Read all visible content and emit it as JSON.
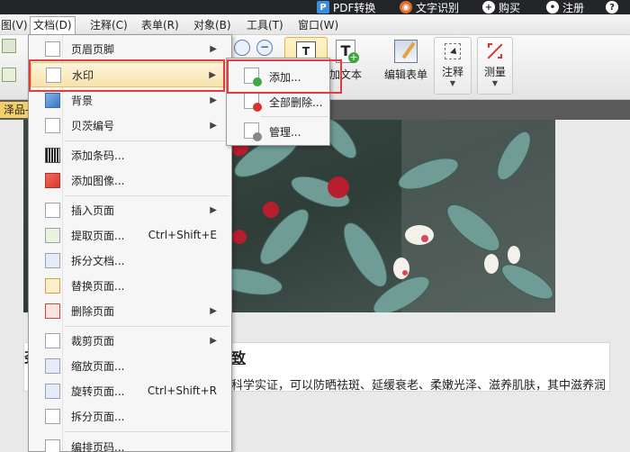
{
  "top_strip": {
    "pdf_convert": "PDF转换",
    "ocr": "文字识别",
    "buy": "购买",
    "register": "注册"
  },
  "menubar": {
    "items": [
      {
        "label": "图(V)"
      },
      {
        "label": "文档(D)"
      },
      {
        "label": "注释(C)"
      },
      {
        "label": "表单(R)"
      },
      {
        "label": "对象(B)"
      },
      {
        "label": "工具(T)"
      },
      {
        "label": "窗口(W)"
      }
    ]
  },
  "toolbar": {
    "add_text": "加文本",
    "edit_form": "编辑表单",
    "annotate": "注释",
    "measure": "测量"
  },
  "tab": {
    "label": "泽品-"
  },
  "document_menu": {
    "items": [
      {
        "label": "页眉页脚",
        "arrow": "▶"
      },
      {
        "label": "水印",
        "arrow": "▶"
      },
      {
        "label": "背景",
        "arrow": "▶"
      },
      {
        "label": "贝茨编号",
        "arrow": "▶"
      },
      {
        "label": "添加条码..."
      },
      {
        "label": "添加图像..."
      },
      {
        "label": "插入页面",
        "arrow": "▶"
      },
      {
        "label": "提取页面...",
        "shortcut": "Ctrl+Shift+E"
      },
      {
        "label": "拆分文档..."
      },
      {
        "label": "替换页面..."
      },
      {
        "label": "删除页面",
        "arrow": "▶"
      },
      {
        "label": "裁剪页面",
        "arrow": "▶"
      },
      {
        "label": "缩放页面..."
      },
      {
        "label": "旋转页面...",
        "shortcut": "Ctrl+Shift+R"
      },
      {
        "label": "拆分页面..."
      },
      {
        "label": "编排页码..."
      }
    ]
  },
  "watermark_submenu": {
    "items": [
      {
        "label": "添加..."
      },
      {
        "label": "全部删除..."
      },
      {
        "label": "管理..."
      }
    ]
  },
  "document": {
    "heading_lead": "劲",
    "heading": "致",
    "body": "科学实证，可以防晒祛斑、延缓衰老、柔嫩光泽、滋养肌肤，其中滋养润"
  },
  "colors": {
    "highlight": "#f7e3ac",
    "red_box": "#e53b3b"
  }
}
